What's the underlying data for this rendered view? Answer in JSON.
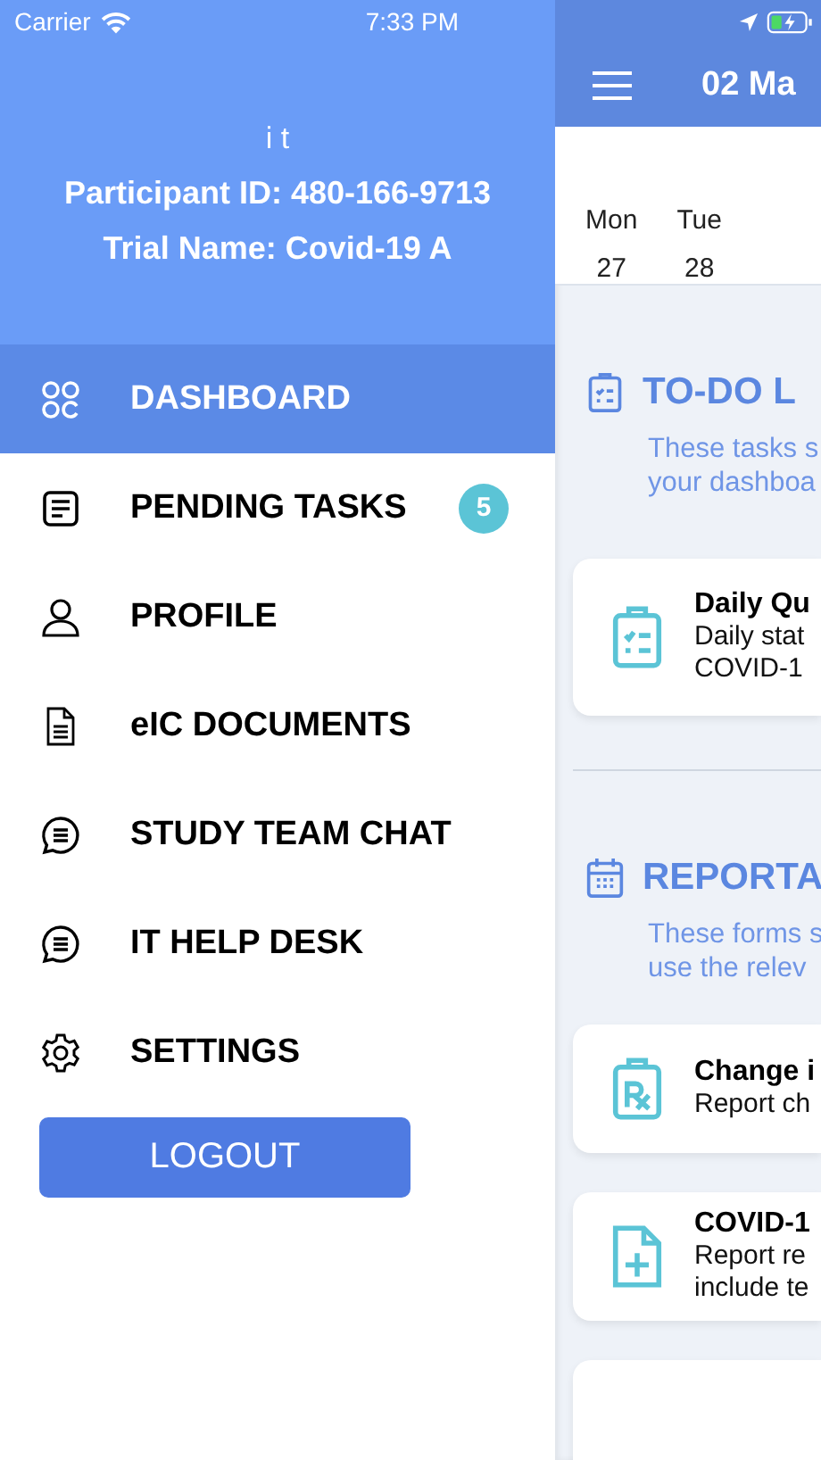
{
  "status_bar": {
    "carrier": "Carrier",
    "time": "7:33 PM"
  },
  "drawer": {
    "user_name": "i t",
    "participant_id": "Participant ID: 480-166-9713",
    "trial_name": "Trial Name: Covid-19 A",
    "items": [
      {
        "label": "DASHBOARD",
        "kind": "grid",
        "selected": true
      },
      {
        "label": "PENDING TASKS",
        "kind": "list",
        "selected": false,
        "badge": "5"
      },
      {
        "label": "PROFILE",
        "kind": "person",
        "selected": false
      },
      {
        "label": "eIC DOCUMENTS",
        "kind": "document",
        "selected": false
      },
      {
        "label": "STUDY TEAM CHAT",
        "kind": "chat",
        "selected": false
      },
      {
        "label": "IT HELP DESK",
        "kind": "chat",
        "selected": false
      },
      {
        "label": "SETTINGS",
        "kind": "gear",
        "selected": false
      }
    ],
    "logout": "LOGOUT"
  },
  "main": {
    "title": "02 Ma",
    "days": [
      {
        "name": "Mon",
        "date": "27"
      },
      {
        "name": "Tue",
        "date": "28"
      }
    ],
    "sections": [
      {
        "kind": "todo",
        "title": "TO-DO L",
        "description": [
          "These tasks s",
          "your dashboa"
        ],
        "cards": [
          {
            "kind": "checklist",
            "title": "Daily Qu",
            "lines": [
              "Daily stat",
              "COVID-1"
            ]
          }
        ]
      },
      {
        "kind": "reports",
        "title": "REPORTA",
        "description": [
          "These forms s",
          "use the relev"
        ],
        "cards": [
          {
            "kind": "rx",
            "title": "Change i",
            "lines": [
              "Report ch"
            ]
          },
          {
            "kind": "file",
            "title": "COVID-1",
            "lines": [
              "Report re",
              "include te"
            ]
          },
          {
            "kind": "blank"
          }
        ]
      }
    ]
  }
}
